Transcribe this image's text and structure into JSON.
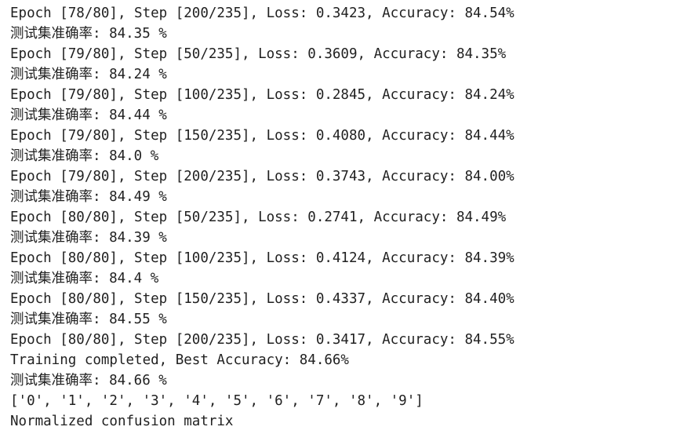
{
  "output": {
    "lines": [
      "Epoch [78/80], Step [200/235], Loss: 0.3423, Accuracy: 84.54%",
      "测试集准确率: 84.35 %",
      "Epoch [79/80], Step [50/235], Loss: 0.3609, Accuracy: 84.35%",
      "测试集准确率: 84.24 %",
      "Epoch [79/80], Step [100/235], Loss: 0.2845, Accuracy: 84.24%",
      "测试集准确率: 84.44 %",
      "Epoch [79/80], Step [150/235], Loss: 0.4080, Accuracy: 84.44%",
      "测试集准确率: 84.0 %",
      "Epoch [79/80], Step [200/235], Loss: 0.3743, Accuracy: 84.00%",
      "测试集准确率: 84.49 %",
      "Epoch [80/80], Step [50/235], Loss: 0.2741, Accuracy: 84.49%",
      "测试集准确率: 84.39 %",
      "Epoch [80/80], Step [100/235], Loss: 0.4124, Accuracy: 84.39%",
      "测试集准确率: 84.4 %",
      "Epoch [80/80], Step [150/235], Loss: 0.4337, Accuracy: 84.40%",
      "测试集准确率: 84.55 %",
      "Epoch [80/80], Step [200/235], Loss: 0.3417, Accuracy: 84.55%",
      "Training completed, Best Accuracy: 84.66%",
      "测试集准确率: 84.66 %",
      "['0', '1', '2', '3', '4', '5', '6', '7', '8', '9']",
      "Normalized confusion matrix"
    ]
  }
}
